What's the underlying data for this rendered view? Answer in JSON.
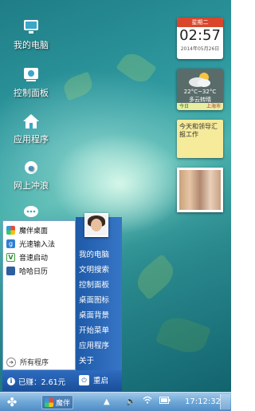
{
  "desktop": {
    "icons": [
      {
        "label": "我的电脑",
        "icon": "computer-icon"
      },
      {
        "label": "控制面板",
        "icon": "control-panel-icon"
      },
      {
        "label": "应用程序",
        "icon": "home-icon"
      },
      {
        "label": "网上冲浪",
        "icon": "browser-icon"
      },
      {
        "label": "",
        "icon": "chat-icon"
      }
    ]
  },
  "widgets": {
    "calendar": {
      "weekday": "星期二",
      "time": "02:57",
      "date": "2014年05月26日"
    },
    "weather": {
      "temp": "22°C~32°C",
      "condition": "多云转晴",
      "today": "今日",
      "city": "上海市"
    },
    "note": {
      "text": "今天和领导汇报工作"
    }
  },
  "start_menu": {
    "apps": [
      {
        "label": "魔伴桌面",
        "icon": "mobo-icon"
      },
      {
        "label": "光速输入法",
        "icon": "input-method-icon"
      },
      {
        "label": "音速启动",
        "icon": "vstart-icon"
      },
      {
        "label": "哈哈日历",
        "icon": "calendar-icon"
      }
    ],
    "all_programs": "所有程序",
    "links": [
      "我的电脑",
      "文明搜索",
      "控制面板",
      "桌面图标",
      "桌面背景",
      "开始菜单",
      "应用程序",
      "关于"
    ],
    "balance": "已赚：2.61元",
    "restart": "重启"
  },
  "taskbar": {
    "start_icon": "clover-icon",
    "active_app": "魔伴",
    "clock": "17:12:32"
  },
  "colors": {
    "taskbar": "#6fa7d6",
    "menu_panel": "#1e5aa8",
    "calendar_header": "#d9462b",
    "note": "#f6eb9b"
  }
}
